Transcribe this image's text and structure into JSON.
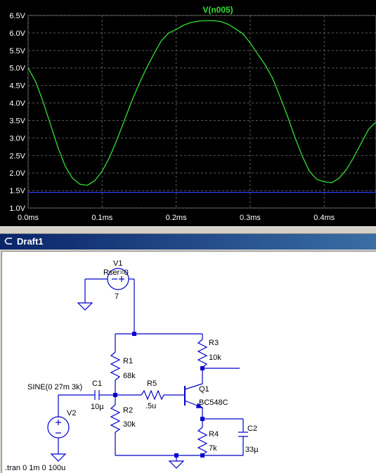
{
  "plot": {
    "trace_label": "V(n005)",
    "y_ticks": [
      "6.5V",
      "6.0V",
      "5.5V",
      "5.0V",
      "4.5V",
      "4.0V",
      "3.5V",
      "3.0V",
      "2.5V",
      "2.0V",
      "1.5V",
      "1.0V"
    ],
    "x_ticks": [
      "0.0ms",
      "0.1ms",
      "0.2ms",
      "0.3ms",
      "0.4ms"
    ],
    "colors": {
      "trace": "#33dd33",
      "grid": "#5a5a5a",
      "title": "#33dd33",
      "baseline": "#2a3dff",
      "text": "#ffffff"
    }
  },
  "chart_data": {
    "type": "line",
    "title": "V(n005)",
    "xlabel": "",
    "ylabel": "",
    "xlim": [
      0.0,
      0.47
    ],
    "ylim": [
      1.0,
      6.5
    ],
    "x_unit": "ms",
    "y_unit": "V",
    "series": [
      {
        "name": "V(n005)",
        "x": [
          0.0,
          0.01,
          0.02,
          0.03,
          0.04,
          0.05,
          0.06,
          0.07,
          0.08,
          0.09,
          0.1,
          0.11,
          0.12,
          0.13,
          0.14,
          0.15,
          0.16,
          0.17,
          0.18,
          0.19,
          0.2,
          0.21,
          0.22,
          0.23,
          0.24,
          0.25,
          0.26,
          0.27,
          0.28,
          0.29,
          0.3,
          0.31,
          0.32,
          0.33,
          0.34,
          0.35,
          0.36,
          0.37,
          0.38,
          0.39,
          0.4,
          0.41,
          0.42,
          0.43,
          0.44,
          0.45,
          0.46,
          0.47
        ],
        "y": [
          5.0,
          4.62,
          4.05,
          3.4,
          2.75,
          2.2,
          1.85,
          1.68,
          1.65,
          1.78,
          2.05,
          2.45,
          2.95,
          3.5,
          4.05,
          4.55,
          5.0,
          5.4,
          5.78,
          6.0,
          6.1,
          6.22,
          6.3,
          6.34,
          6.35,
          6.35,
          6.33,
          6.25,
          6.12,
          5.98,
          5.72,
          5.4,
          5.1,
          4.72,
          4.2,
          3.65,
          3.05,
          2.5,
          2.05,
          1.82,
          1.75,
          1.72,
          1.85,
          2.1,
          2.45,
          2.85,
          3.25,
          3.45
        ]
      },
      {
        "name": "",
        "x": [
          0.0,
          0.47
        ],
        "y": [
          1.45,
          1.45
        ]
      }
    ],
    "grid": true
  },
  "window": {
    "title": "Draft1"
  },
  "schematic": {
    "v1": {
      "name": "V1",
      "value": "7",
      "param": "Rser=0"
    },
    "v2": {
      "name": "V2",
      "source": "SINE(0 27m 3k)"
    },
    "r1": {
      "name": "R1",
      "value": "68k"
    },
    "r2": {
      "name": "R2",
      "value": "30k"
    },
    "r3": {
      "name": "R3",
      "value": "10k"
    },
    "r4": {
      "name": "R4",
      "value": "7k"
    },
    "r5": {
      "name": "R5",
      "value": ".5u"
    },
    "c1": {
      "name": "C1",
      "value": "10µ"
    },
    "c2": {
      "name": "C2",
      "value": "33µ"
    },
    "q1": {
      "name": "Q1",
      "model": "BC548C"
    },
    "directive": ".tran 0 1m 0 100u",
    "colors": {
      "wire": "#0000cc",
      "text": "#000000",
      "junction": "#0000cc"
    }
  }
}
